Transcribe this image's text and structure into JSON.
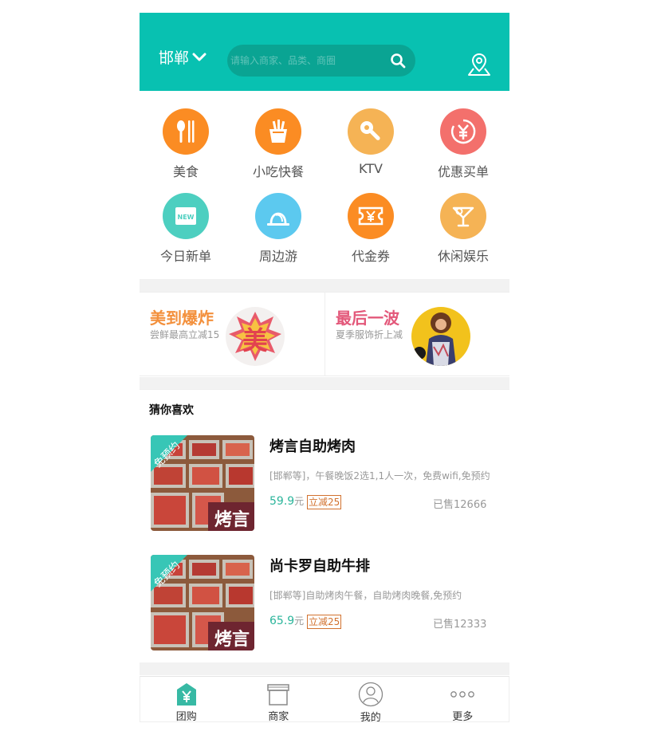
{
  "header": {
    "city": "邯郸",
    "search_placeholder": "请输入商家、品类、商圈"
  },
  "categories": [
    {
      "label": "美食",
      "icon": "food-utensils-icon",
      "color": "#fb8c23"
    },
    {
      "label": "小吃快餐",
      "icon": "fries-icon",
      "color": "#fb8c23"
    },
    {
      "label": "KTV",
      "icon": "microphone-icon",
      "color": "#f5b355"
    },
    {
      "label": "优惠买单",
      "icon": "yen-discount-icon",
      "color": "#f3706c"
    },
    {
      "label": "今日新单",
      "icon": "new-badge-icon",
      "color": "#4dcfc0"
    },
    {
      "label": "周边游",
      "icon": "tent-icon",
      "color": "#5cc9ef"
    },
    {
      "label": "代金券",
      "icon": "voucher-icon",
      "color": "#fb8c23"
    },
    {
      "label": "休闲娱乐",
      "icon": "cocktail-icon",
      "color": "#f5b355"
    }
  ],
  "promos": [
    {
      "title": "美到爆炸",
      "subtitle": "尝鲜最高立减15",
      "title_color": "#f3903c"
    },
    {
      "title": "最后一波",
      "subtitle": "夏季服饰折上减",
      "title_color": "#e3587a"
    }
  ],
  "promo_badge_text": "美",
  "recommend": {
    "heading": "猜你喜欢",
    "items": [
      {
        "title": "烤言自助烤肉",
        "desc": "[邯郸等]，午餐晚饭2选1,1人一次，免费wifi,免预约",
        "price": "59.9",
        "unit": "元",
        "discount": "立减25",
        "sold": "已售12666",
        "ribbon": "免预约",
        "brand": "烤言"
      },
      {
        "title": "尚卡罗自助牛排",
        "desc": "[邯郸等]自助烤肉午餐，自助烤肉晚餐,免预约",
        "price": "65.9",
        "unit": "元",
        "discount": "立减25",
        "sold": "已售12333",
        "ribbon": "免预约",
        "brand": "烤言"
      }
    ]
  },
  "tabs": [
    {
      "label": "团购",
      "icon": "yen-tag-icon",
      "active": true
    },
    {
      "label": "商家",
      "icon": "shop-icon",
      "active": false
    },
    {
      "label": "我的",
      "icon": "user-icon",
      "active": false
    },
    {
      "label": "更多",
      "icon": "more-dots-icon",
      "active": false
    }
  ],
  "colors": {
    "primary": "#08c1b1",
    "search_bg": "#0aa493",
    "price": "#2bb59b",
    "discount": "#d2722f"
  }
}
